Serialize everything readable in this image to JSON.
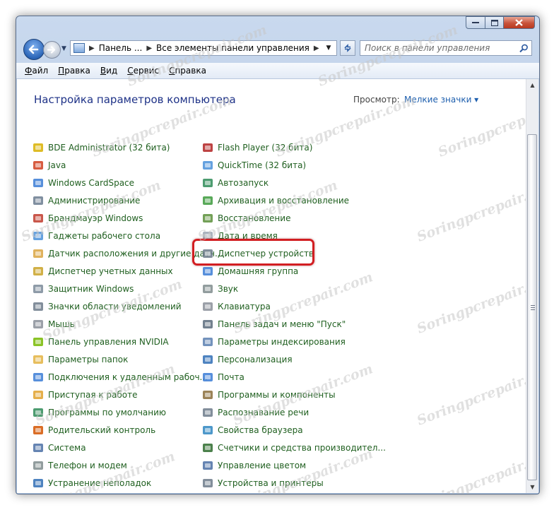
{
  "window": {
    "address": {
      "crumbs": [
        "Панель ...",
        "Все элементы панели управления"
      ]
    },
    "search": {
      "placeholder": "Поиск в панели управления"
    },
    "menu": [
      {
        "hot": "Ф",
        "rest": "айл"
      },
      {
        "hot": "П",
        "rest": "равка"
      },
      {
        "hot": "В",
        "rest": "ид"
      },
      {
        "hot": "С",
        "rest": "ервис"
      },
      {
        "hot": "С",
        "rest": "правка"
      }
    ]
  },
  "content": {
    "title": "Настройка параметров компьютера",
    "view_label": "Просмотр:",
    "view_value": "Мелкие значки ▾",
    "left_items": [
      "BDE Administrator (32 бита)",
      "Java",
      "Windows CardSpace",
      "Администрирование",
      "Брандмауэр Windows",
      "Гаджеты рабочего стола",
      "Датчик расположения и другие датч...",
      "Диспетчер учетных данных",
      "Защитник Windows",
      "Значки области уведомлений",
      "Мышь",
      "Панель управления NVIDIA",
      "Параметры папок",
      "Подключения к удаленным рабоч...",
      "Приступая к работе",
      "Программы по умолчанию",
      "Родительский контроль",
      "Система",
      "Телефон и модем",
      "Устранение неполадок"
    ],
    "right_items": [
      "Flash Player (32 бита)",
      "QuickTime (32 бита)",
      "Автозапуск",
      "Архивация и восстановление",
      "Восстановление",
      "Дата и время",
      "Диспетчер устройств",
      "Домашняя группа",
      "Звук",
      "Клавиатура",
      "Панель задач и меню \"Пуск\"",
      "Параметры индексирования",
      "Персонализация",
      "Почта",
      "Программы и компоненты",
      "Распознавание речи",
      "Свойства браузера",
      "Счетчики и средства производител...",
      "Управление цветом",
      "Устройства и принтеры"
    ],
    "left_icon_colors": [
      "#d8b000",
      "#d04020",
      "#3a7bd5",
      "#6a7b8f",
      "#c0392b",
      "#4a90d9",
      "#d9a441",
      "#c9a227",
      "#7a8a99",
      "#6c7a89",
      "#8a8f99",
      "#76b900",
      "#e3b341",
      "#3a7bd5",
      "#e1a12b",
      "#2e8b57",
      "#d35400",
      "#4a6fa5",
      "#7f8c8d",
      "#2f6db5"
    ],
    "right_icon_colors": [
      "#b22222",
      "#4a90d9",
      "#2e8b57",
      "#3c9a3c",
      "#5a8f3a",
      "#9aa5b1",
      "#6c7a89",
      "#3a7bd5",
      "#7f8c8d",
      "#8a8f99",
      "#5b6b7b",
      "#5a7fb0",
      "#2f6db5",
      "#3a7bd5",
      "#8a6d3b",
      "#6c7a89",
      "#2e86c1",
      "#2d6b2d",
      "#4a6fa5",
      "#6c7a89"
    ]
  }
}
